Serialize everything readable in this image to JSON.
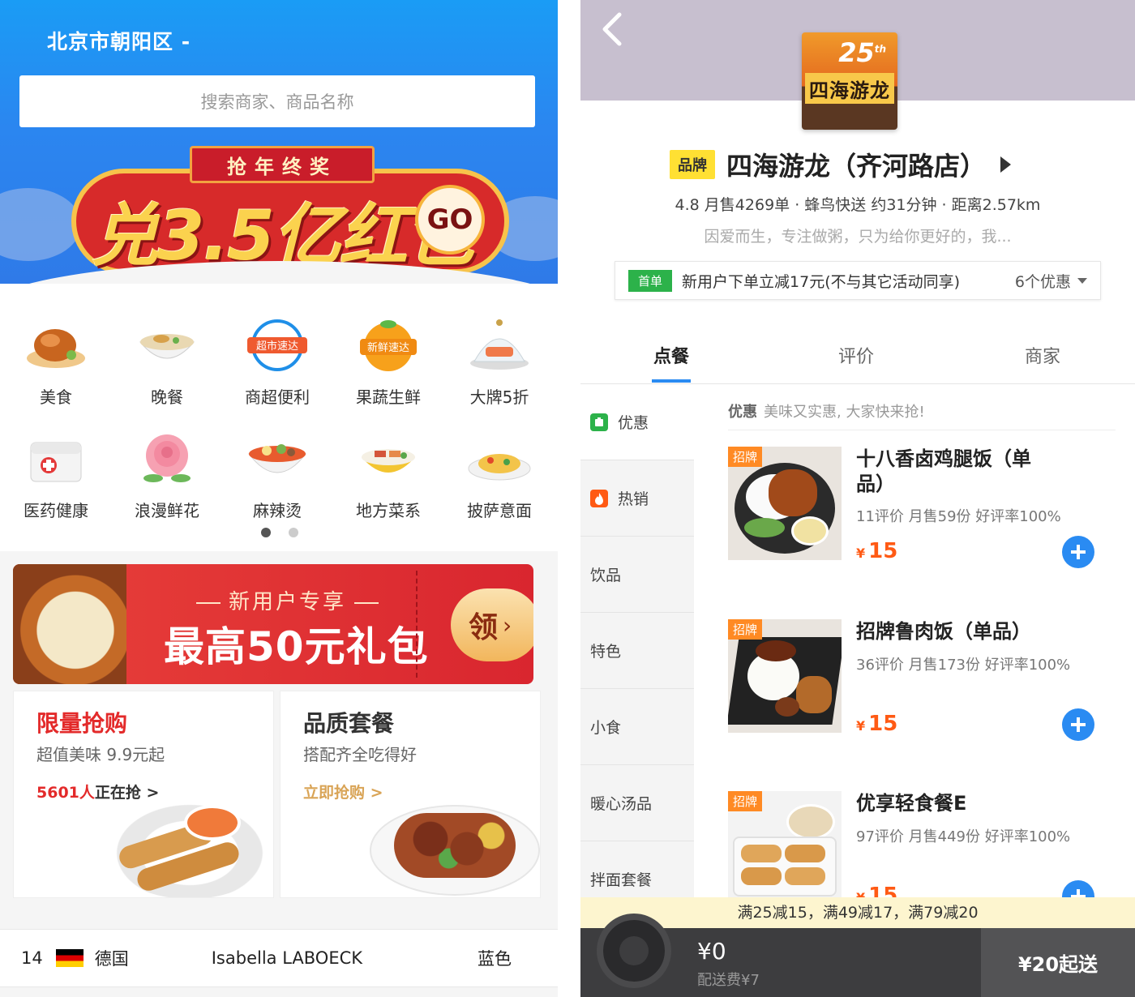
{
  "left": {
    "location": "北京市朝阳区 -",
    "search_placeholder": "搜索商家、商品名称",
    "banner": {
      "tag": "抢年终奖",
      "headline": "兑3.5亿红包",
      "go": "GO"
    },
    "categories": [
      {
        "label": "美食",
        "icon": "roast-chicken-icon"
      },
      {
        "label": "晚餐",
        "icon": "noodle-bowl-icon"
      },
      {
        "label": "商超便利",
        "icon": "supermarket-express-icon",
        "badge": "超市速达"
      },
      {
        "label": "果蔬生鲜",
        "icon": "fresh-express-icon",
        "badge": "新鲜速达"
      },
      {
        "label": "大牌5折",
        "icon": "salmon-dome-icon"
      },
      {
        "label": "医药健康",
        "icon": "medicine-box-icon"
      },
      {
        "label": "浪漫鲜花",
        "icon": "rose-icon"
      },
      {
        "label": "麻辣烫",
        "icon": "hotpot-bowl-icon"
      },
      {
        "label": "地方菜系",
        "icon": "regional-dish-icon"
      },
      {
        "label": "披萨意面",
        "icon": "pasta-icon"
      }
    ],
    "promo": {
      "subtitle": "新用户专享",
      "main": "最高50元礼包",
      "claim": "领",
      "claim_arrow": "›"
    },
    "cards": [
      {
        "title": "限量抢购",
        "subtitle": "超值美味 9.9元起",
        "link_count": "5601人",
        "link_rest": "正在抢 >"
      },
      {
        "title": "品质套餐",
        "subtitle": "搭配齐全吃得好",
        "link_rest": "立即抢购 >"
      }
    ],
    "bottom_row": {
      "rank": "14",
      "country": "德国",
      "name": "Isabella LABOECK",
      "color": "蓝色"
    }
  },
  "right": {
    "logo": {
      "years": "25",
      "years_sup": "th",
      "name": "四海游龙"
    },
    "brand_tag": "品牌",
    "store_name": "四海游龙（齐河路店）",
    "stats": "4.8  月售4269单 · 蜂鸟快送 约31分钟 · 距离2.57km",
    "description": "因爱而生，专注做粥，只为给你更好的，我...",
    "offer": {
      "tag": "首单",
      "text": "新用户下单立减17元(不与其它活动同享)",
      "count": "6个优惠"
    },
    "tabs": [
      "点餐",
      "评价",
      "商家"
    ],
    "sidebar": [
      {
        "label": "优惠",
        "icon": "discount-icon",
        "icon_color": "#2cb24a"
      },
      {
        "label": "热销",
        "icon": "flame-icon",
        "icon_color": "#ff5a14"
      },
      {
        "label": "饮品"
      },
      {
        "label": "特色"
      },
      {
        "label": "小食"
      },
      {
        "label": "暖心汤品"
      },
      {
        "label": "拌面套餐"
      }
    ],
    "section": {
      "title": "优惠",
      "subtitle": "美味又实惠, 大家快来抢!"
    },
    "dishes": [
      {
        "badge": "招牌",
        "name": "十八香卤鸡腿饭（单品）",
        "meta": "11评价 月售59份  好评率100%",
        "currency": "¥",
        "price": "15"
      },
      {
        "badge": "招牌",
        "name": "招牌鲁肉饭（单品）",
        "meta": "36评价 月售173份  好评率100%",
        "currency": "¥",
        "price": "15"
      },
      {
        "badge": "招牌",
        "name": "优享轻食餐E",
        "meta": "97评价 月售449份  好评率100%",
        "currency": "¥",
        "price": "15"
      }
    ],
    "discount_bar": "满25减15，满49减17，满79减20",
    "cart": {
      "total": "¥0",
      "fee": "配送费¥7",
      "min_order": "¥20起送"
    }
  },
  "colors": {
    "accent_blue": "#2a8bf2",
    "price_orange": "#ff5a14",
    "brand_yellow": "#ffe033",
    "promo_red": "#e8403a"
  }
}
